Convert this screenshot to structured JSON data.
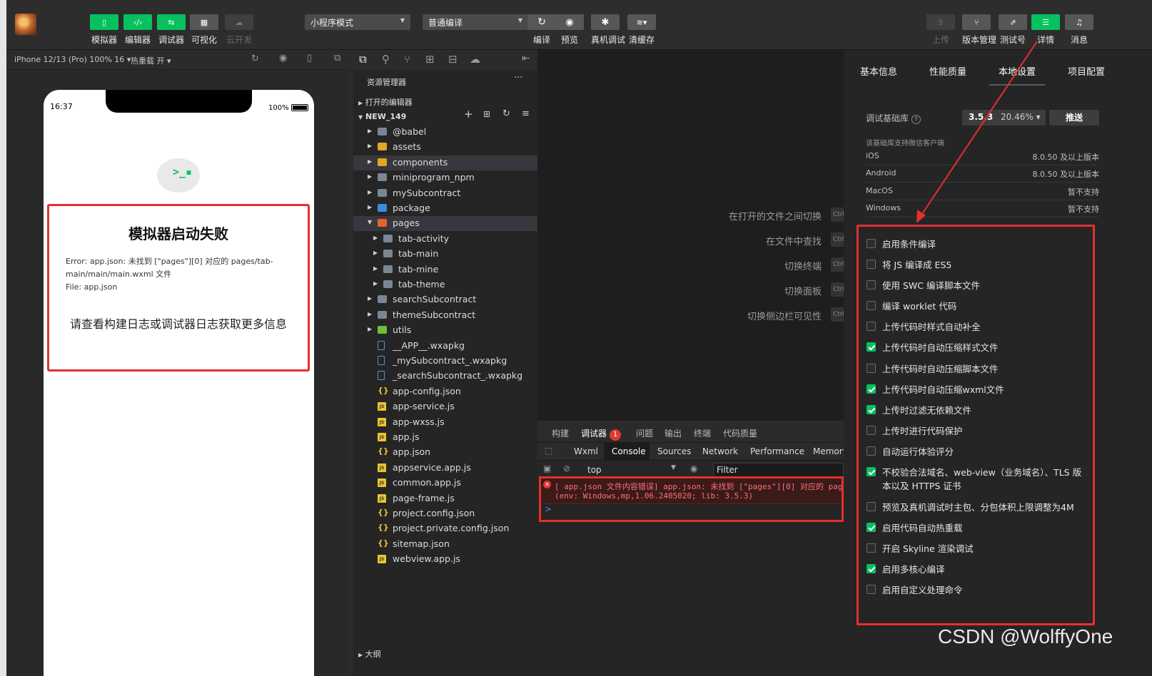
{
  "toolbar": {
    "buttons": [
      {
        "label": "模拟器",
        "icon": "phone-icon"
      },
      {
        "label": "编辑器",
        "icon": "code-icon"
      },
      {
        "label": "调试器",
        "icon": "debug-icon"
      },
      {
        "label": "可视化",
        "icon": "layout-icon"
      },
      {
        "label": "云开发",
        "icon": "cloud-icon"
      }
    ],
    "mode_select": "小程序模式",
    "compile_select": "普通编译",
    "actions": [
      {
        "label": "编译",
        "icon": "refresh-icon"
      },
      {
        "label": "预览",
        "icon": "eye-icon"
      },
      {
        "label": "真机调试",
        "icon": "bug-icon"
      },
      {
        "label": "清缓存",
        "icon": "layers-icon"
      }
    ],
    "right": [
      {
        "label": "上传",
        "icon": "upload-icon"
      },
      {
        "label": "版本管理",
        "icon": "branch-icon"
      },
      {
        "label": "测试号",
        "icon": "external-icon"
      },
      {
        "label": "详情",
        "icon": "menu-icon"
      },
      {
        "label": "消息",
        "icon": "bell-icon"
      }
    ]
  },
  "simulator": {
    "device": "iPhone 12/13 (Pro) 100% 16 ▾",
    "hot_reload": "热重载 开 ▾",
    "time": "16:37",
    "battery": "100%",
    "bubble_text": ">_▪",
    "error_title": "模拟器启动失败",
    "error_message": "Error: app.json: 未找到 [\"pages\"][0] 对应的 pages/tab-main/main/main.wxml 文件",
    "error_file": "File: app.json",
    "error_hint": "请查看构建日志或调试器日志获取更多信息"
  },
  "explorer": {
    "title": "资源管理器",
    "more": "···",
    "open_editors": "打开的编辑器",
    "project": "NEW_149",
    "outline": "大纲",
    "items": [
      {
        "name": "@babel",
        "type": "folder",
        "depth": 0
      },
      {
        "name": "assets",
        "type": "yfolder",
        "depth": 0
      },
      {
        "name": "components",
        "type": "yfolder",
        "depth": 0
      },
      {
        "name": "miniprogram_npm",
        "type": "folder",
        "depth": 0
      },
      {
        "name": "mySubcontract",
        "type": "folder",
        "depth": 0
      },
      {
        "name": "package",
        "type": "bfolder",
        "depth": 0
      },
      {
        "name": "pages",
        "type": "rfolder",
        "depth": 0
      },
      {
        "name": "tab-activity",
        "type": "folder",
        "depth": 1
      },
      {
        "name": "tab-main",
        "type": "folder",
        "depth": 1
      },
      {
        "name": "tab-mine",
        "type": "folder",
        "depth": 1
      },
      {
        "name": "tab-theme",
        "type": "folder",
        "depth": 1
      },
      {
        "name": "searchSubcontract",
        "type": "folder",
        "depth": 0
      },
      {
        "name": "themeSubcontract",
        "type": "folder",
        "depth": 0
      },
      {
        "name": "utils",
        "type": "gfolder",
        "depth": 0
      },
      {
        "name": "__APP__.wxapkg",
        "type": "file",
        "depth": 0
      },
      {
        "name": "_mySubcontract_.wxapkg",
        "type": "file",
        "depth": 0
      },
      {
        "name": "_searchSubcontract_.wxapkg",
        "type": "file",
        "depth": 0
      },
      {
        "name": "app-config.json",
        "type": "json",
        "depth": 0
      },
      {
        "name": "app-service.js",
        "type": "js",
        "depth": 0
      },
      {
        "name": "app-wxss.js",
        "type": "js",
        "depth": 0
      },
      {
        "name": "app.js",
        "type": "js",
        "depth": 0
      },
      {
        "name": "app.json",
        "type": "json",
        "depth": 0
      },
      {
        "name": "appservice.app.js",
        "type": "js",
        "depth": 0
      },
      {
        "name": "common.app.js",
        "type": "js",
        "depth": 0
      },
      {
        "name": "page-frame.js",
        "type": "js",
        "depth": 0
      },
      {
        "name": "project.config.json",
        "type": "json",
        "depth": 0
      },
      {
        "name": "project.private.config.json",
        "type": "json",
        "depth": 0
      },
      {
        "name": "sitemap.json",
        "type": "json",
        "depth": 0
      },
      {
        "name": "webview.app.js",
        "type": "js",
        "depth": 0
      }
    ]
  },
  "editor": {
    "shortcuts": [
      {
        "label": "在打开的文件之间切换",
        "key": "Ctrl"
      },
      {
        "label": "在文件中查找",
        "key": "Ctrl"
      },
      {
        "label": "切换终端",
        "key": "Ctrl"
      },
      {
        "label": "切换面板",
        "key": "Ctrl"
      },
      {
        "label": "切换侧边栏可见性",
        "key": "Ctrl"
      }
    ]
  },
  "debugger": {
    "tabs": [
      "构建",
      "调试器",
      "问题",
      "输出",
      "终端",
      "代码质量"
    ],
    "badge": "1",
    "devtools_tabs": [
      "Wxml",
      "Console",
      "Sources",
      "Network",
      "Performance",
      "Memory"
    ],
    "context": "top",
    "filter_placeholder": "Filter",
    "error_line1": "[ app.json 文件内容错误] app.json: 未找到 [\"pages\"][0] 对应的 pag",
    "error_line2": "(env: Windows,mp,1.06.2405020; lib: 3.5.3)",
    "prompt": ">"
  },
  "details": {
    "tabs": [
      "基本信息",
      "性能质量",
      "本地设置",
      "项目配置"
    ],
    "active_tab": "本地设置",
    "lib_label": "调试基础库",
    "lib_version": "3.5.3",
    "lib_percent": "20.46% ▾",
    "push_button": "推送",
    "support_note": "该基础库支持微信客户端",
    "platforms": [
      {
        "name": "iOS",
        "value": "8.0.50 及以上版本"
      },
      {
        "name": "Android",
        "value": "8.0.50 及以上版本"
      },
      {
        "name": "MacOS",
        "value": "暂不支持"
      },
      {
        "name": "Windows",
        "value": "暂不支持"
      }
    ],
    "options": [
      {
        "label": "启用条件编译",
        "checked": false
      },
      {
        "label": "将 JS 编译成 ES5",
        "checked": false
      },
      {
        "label": "使用 SWC 编译脚本文件",
        "checked": false
      },
      {
        "label": "编译 worklet 代码",
        "checked": false
      },
      {
        "label": "上传代码时样式自动补全",
        "checked": false
      },
      {
        "label": "上传代码时自动压缩样式文件",
        "checked": true
      },
      {
        "label": "上传代码时自动压缩脚本文件",
        "checked": false
      },
      {
        "label": "上传代码时自动压缩wxml文件",
        "checked": true
      },
      {
        "label": "上传时过滤无依赖文件",
        "checked": true
      },
      {
        "label": "上传时进行代码保护",
        "checked": false
      },
      {
        "label": "自动运行体验评分",
        "checked": false
      },
      {
        "label": "不校验合法域名、web-view（业务域名）、TLS 版本以及 HTTPS 证书",
        "checked": true
      },
      {
        "label": "预览及真机调试时主包、分包体积上限调整为4M",
        "checked": false
      },
      {
        "label": "启用代码自动热重载",
        "checked": true
      },
      {
        "label": "开启 Skyline 渲染调试",
        "checked": false
      },
      {
        "label": "启用多核心编译",
        "checked": true
      },
      {
        "label": "启用自定义处理命令",
        "checked": false
      }
    ]
  },
  "watermark": "CSDN @WolffyOne",
  "colors": {
    "accent": "#07c160",
    "annotation": "#e3302f",
    "error_text": "#ff7070"
  }
}
